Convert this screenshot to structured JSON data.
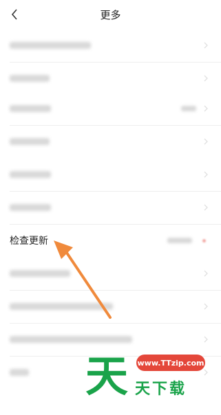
{
  "header": {
    "back_icon": "chevron-left-icon",
    "title": "更多"
  },
  "check_update": {
    "label": "检查更新"
  },
  "watermark": {
    "url": "www.TTzip.com",
    "logo_char": "天",
    "text": "天下载"
  },
  "colors": {
    "arrow": "#f08a3c",
    "watermark_green": "#1aa34a",
    "watermark_red": "#e4473a"
  }
}
